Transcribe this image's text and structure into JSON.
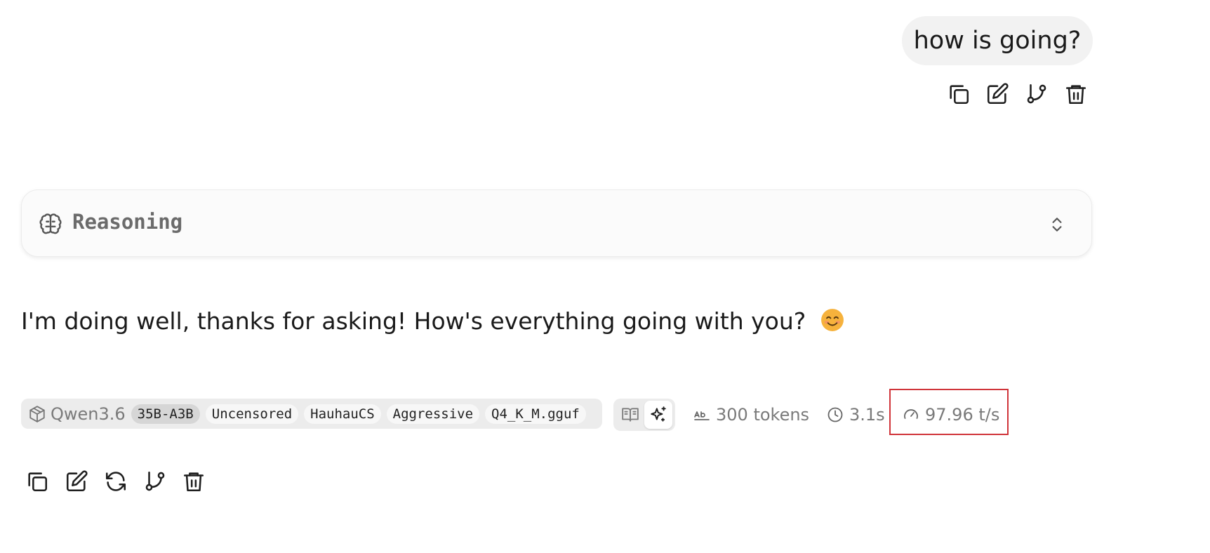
{
  "user_message": {
    "text": "how is going?",
    "actions": [
      "copy-icon",
      "edit-icon",
      "branch-icon",
      "trash-icon"
    ]
  },
  "reasoning": {
    "label": "Reasoning",
    "icon": "brain-icon",
    "toggle_icon": "chevrons-up-down-icon"
  },
  "assistant_message": {
    "text": "I'm doing well, thanks for asking! How's everything going with you?",
    "emoji": "smiling-face-emoji"
  },
  "model_info": {
    "name": "Qwen3.6",
    "tags": [
      "35B-A3B",
      "Uncensored",
      "HauhauCS",
      "Aggressive",
      "Q4_K_M.gguf"
    ],
    "highlighted_tag": "35B-A3B"
  },
  "mode_toggle": {
    "options": [
      "book-icon",
      "sparkles-icon"
    ],
    "selected": "sparkles-icon"
  },
  "stats": {
    "tokens": "300 tokens",
    "time": "3.1s",
    "speed": "97.96 t/s"
  },
  "assistant_actions": [
    "copy-icon",
    "edit-icon",
    "regenerate-icon",
    "branch-icon",
    "trash-icon"
  ],
  "colors": {
    "bubble_bg": "#f2f2f2",
    "pill_bg": "#ececec",
    "highlight_border": "#d0343a",
    "muted_text": "#7a7a7a"
  }
}
